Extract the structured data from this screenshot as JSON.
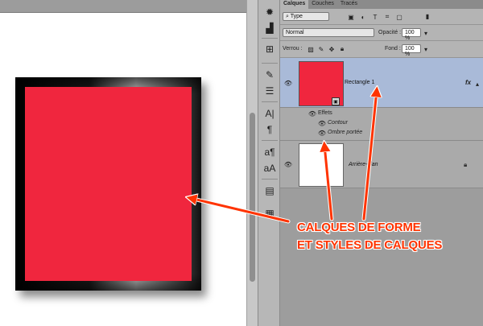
{
  "panel": {
    "tabs": [
      {
        "label": "Calques"
      },
      {
        "label": "Couches"
      },
      {
        "label": "Tracés"
      }
    ],
    "filter": {
      "value": "Type"
    },
    "blend_mode": {
      "value": "Normal"
    },
    "opacity": {
      "label": "Opacité :",
      "value": "100 %"
    },
    "lock": {
      "label": "Verrou :"
    },
    "fill": {
      "label": "Fond :",
      "value": "100 %"
    }
  },
  "layers": [
    {
      "name": "Rectangle 1",
      "thumbnail_color": "#f0263e",
      "selected": true,
      "fx": "fx",
      "effects_label": "Effets",
      "effects": [
        {
          "label": "Contour"
        },
        {
          "label": "Ombre portée"
        }
      ]
    },
    {
      "name": "Arrière-plan",
      "thumbnail_color": "#ffffff",
      "locked": true
    }
  ],
  "canvas": {
    "shape_color": "#f0263e"
  },
  "callout": {
    "line1": "CALQUES DE FORME",
    "line2": "ET STYLES DE CALQUES",
    "color": "#ff3300"
  },
  "icons": {
    "tools": [
      "histogram-icon",
      "levels-icon",
      "swatches-icon",
      "brush-icon",
      "adjust-icon",
      "character-icon",
      "paragraph-icon",
      "char-style-icon",
      "para-style-icon",
      "notes-icon",
      "navigator-icon"
    ]
  }
}
